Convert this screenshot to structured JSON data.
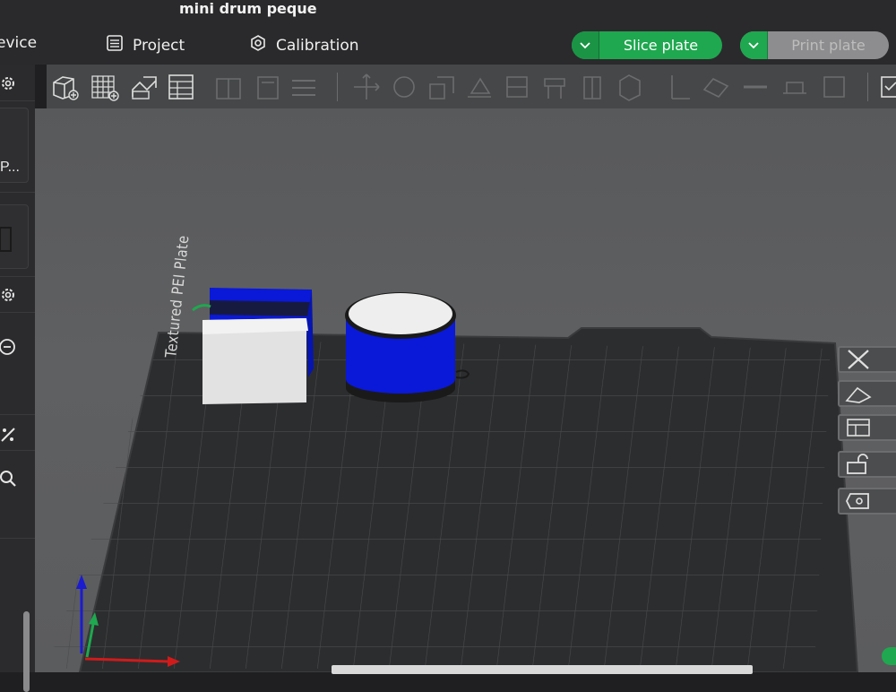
{
  "window": {
    "title": "mini drum peque"
  },
  "nav": {
    "device": "evice",
    "project": "Project",
    "calibration": "Calibration",
    "slice_plate": "Slice plate",
    "print_plate": "Print plate"
  },
  "sidebar": {
    "truncated_label": "P..."
  },
  "viewport": {
    "plate_label": "Textured PEI Plate"
  },
  "toolbar": {
    "icons": [
      "add-cube-icon",
      "add-grid-icon",
      "auto-orient-icon",
      "arrange-icon",
      "split-icon",
      "layers-icon",
      "align-icon",
      "move-icon",
      "rotate-icon",
      "scale-icon",
      "lay-on-face-icon",
      "cut-icon",
      "support-icon",
      "seam-icon",
      "text-icon",
      "measure-icon",
      "assembly-icon",
      "brim-ears-icon",
      "variable-layer-icon",
      "emboss-icon"
    ]
  },
  "colors": {
    "accent_green": "#1fa84f",
    "model_blue": "#0a19d8",
    "plate_dark": "#2c2d2f",
    "viewport_bg": "#5e5f61"
  }
}
